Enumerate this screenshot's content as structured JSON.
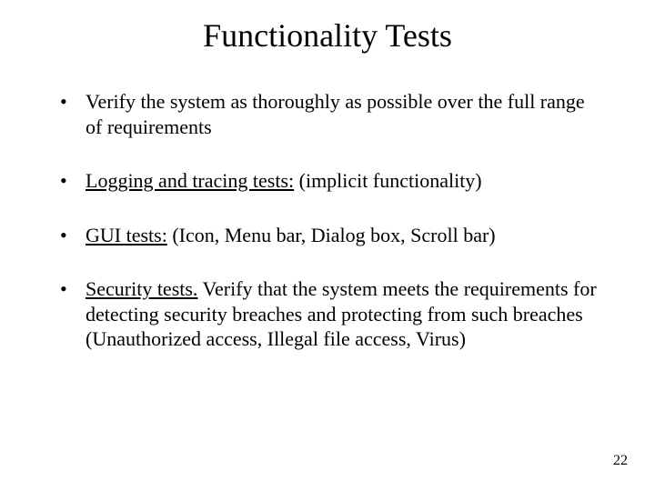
{
  "title": "Functionality Tests",
  "bullets": [
    {
      "lead_underlined": "",
      "rest": "Verify the system as thoroughly as possible over the full range of requirements"
    },
    {
      "lead_underlined": "Logging and tracing tests:",
      "rest": " (implicit functionality)"
    },
    {
      "lead_underlined": "GUI tests:",
      "rest": " (Icon, Menu bar, Dialog box, Scroll bar)"
    },
    {
      "lead_underlined": "Security tests.",
      "rest": " Verify that the system meets the requirements for detecting security breaches and protecting from such breaches (Unauthorized access, Illegal file access, Virus)"
    }
  ],
  "page_number": "22"
}
